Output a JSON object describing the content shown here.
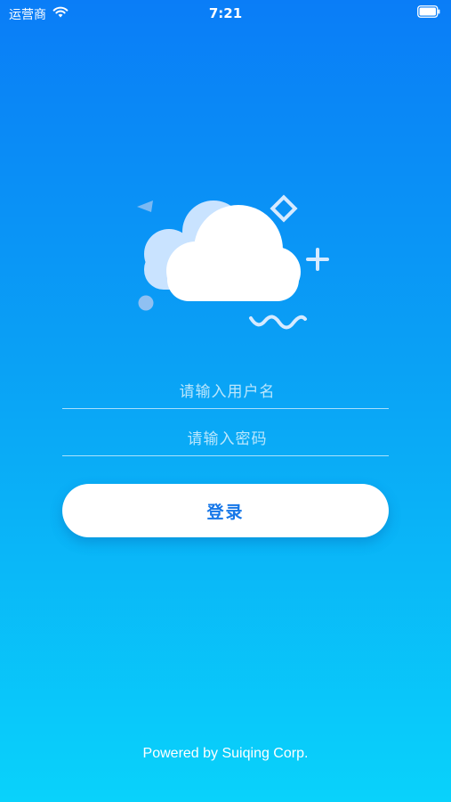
{
  "status_bar": {
    "carrier": "运营商",
    "time": "7:21",
    "wifi_icon": "wifi-icon",
    "battery_icon": "battery-icon"
  },
  "illustration": {
    "icon": "cloud-icon",
    "accent_color": "#c9e3ff"
  },
  "form": {
    "username_placeholder": "请输入用户名",
    "username_value": "",
    "password_placeholder": "请输入密码",
    "password_value": ""
  },
  "login_button": {
    "label": "登录",
    "text_color": "#1677e8"
  },
  "footer": {
    "text": "Powered by Suiqing Corp."
  },
  "colors": {
    "gradient_top": "#0a7df7",
    "gradient_bottom": "#09d2fb"
  }
}
